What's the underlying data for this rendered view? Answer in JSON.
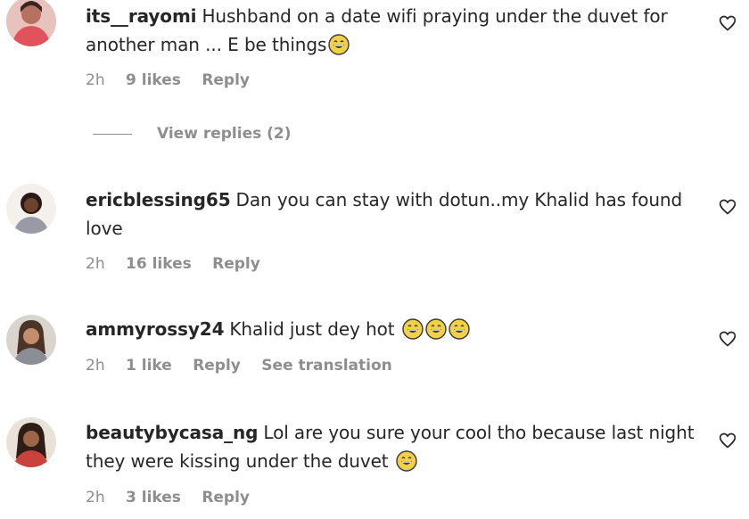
{
  "comments": [
    {
      "username": "its__rayomi",
      "text": "Hushband on a date wifi praying under the duvet for another man ... E be things",
      "emoji": [
        "grinning-sweat-emoji"
      ],
      "time": "2h",
      "likes": "9 likes",
      "reply": "Reply"
    },
    {
      "username": "ericblessing65",
      "text": "Dan you can stay with dotun..my Khalid has found love",
      "emoji": [],
      "time": "2h",
      "likes": "16 likes",
      "reply": "Reply"
    },
    {
      "username": "ammyrossy24",
      "text": "Khalid just dey hot",
      "emoji": [
        "grinning-sweat-emoji",
        "grinning-sweat-emoji",
        "grinning-sweat-emoji"
      ],
      "time": "2h",
      "likes": "1 like",
      "reply": "Reply",
      "translate": "See translation"
    },
    {
      "username": "beautybycasa_ng",
      "text": "Lol are you sure your cool tho because last night they were kissing under the duvet",
      "emoji": [
        "grinning-sweat-emoji"
      ],
      "time": "2h",
      "likes": "3 likes",
      "reply": "Reply"
    }
  ],
  "view_replies": "View replies (2)",
  "colors": {
    "text": "#262626",
    "meta": "#8e8e8e",
    "background": "#ffffff"
  }
}
